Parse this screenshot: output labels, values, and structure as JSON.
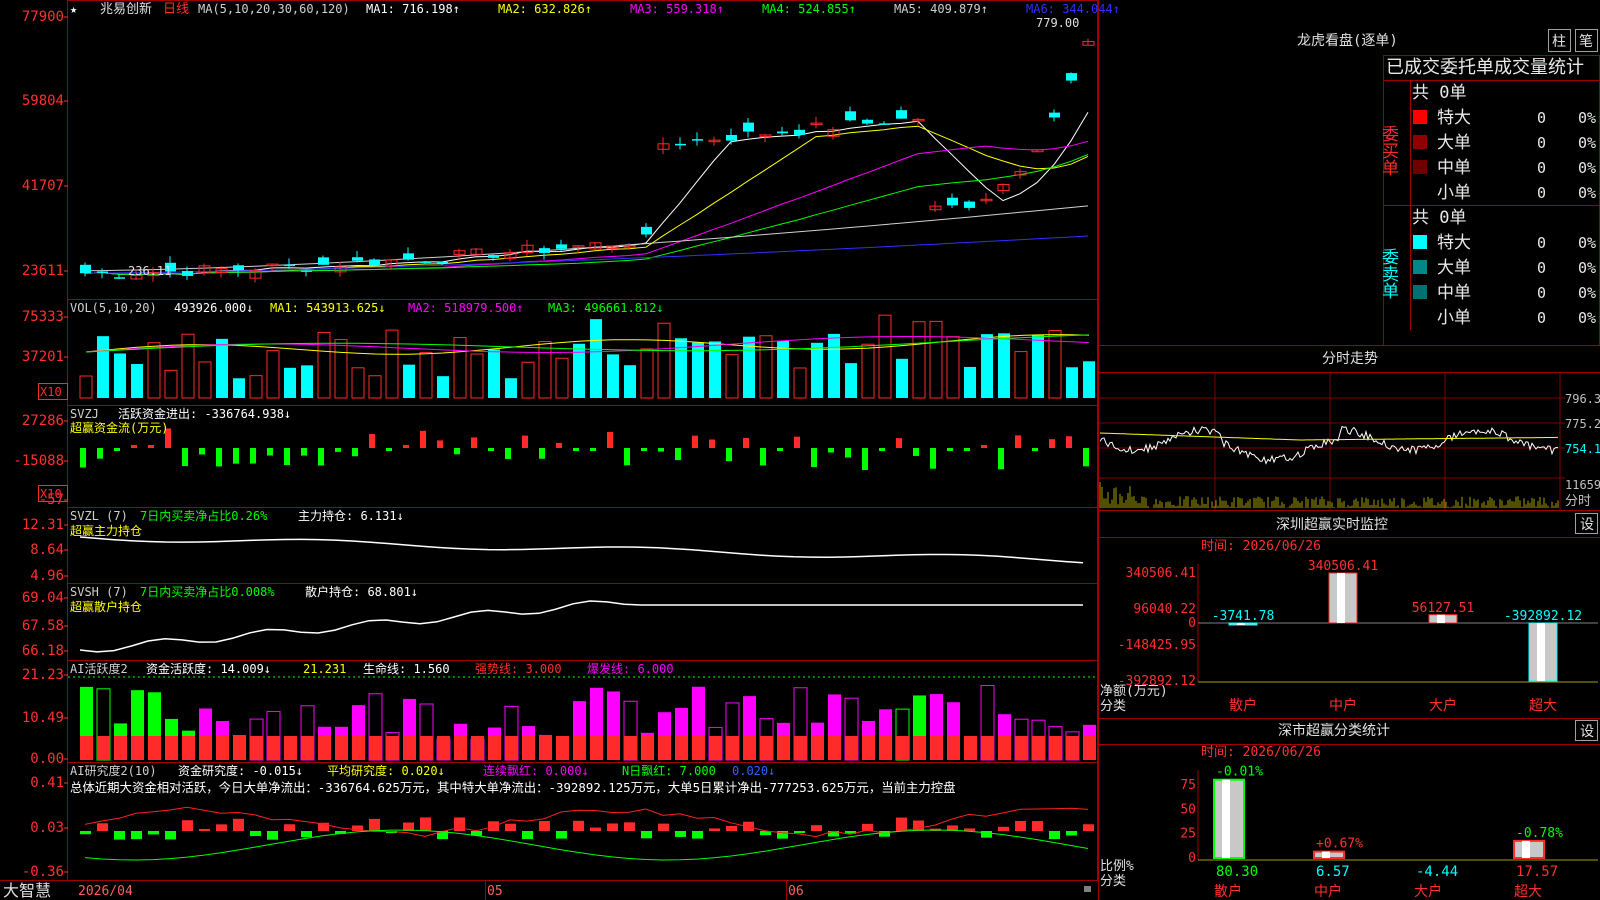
{
  "app": {
    "name": "大智慧",
    "stock_name": "兆易创新",
    "period": "日线",
    "star": "★"
  },
  "colors": {
    "up": "#ff2a2a",
    "down": "#00ffff",
    "frame": "#a00000",
    "white": "#e8e8e8",
    "yellow": "#ffff00",
    "magenta": "#ff00ff",
    "green": "#00ff00",
    "blue": "#4040ff",
    "gray": "#b0b0b0",
    "grid": "#800000"
  },
  "main": {
    "y_labels": [
      "77900",
      "59804",
      "41707",
      "23611"
    ],
    "ma_title": "MA(5,10,20,30,60,120)",
    "ma": [
      {
        "label": "MA1: 716.198↑",
        "color": "#ffffff"
      },
      {
        "label": "MA2: 632.826↑",
        "color": "#ffff00"
      },
      {
        "label": "MA3: 559.318↑",
        "color": "#ff00ff"
      },
      {
        "label": "MA4: 524.855↑",
        "color": "#00ff00"
      },
      {
        "label": "MA5: 409.879↑",
        "color": "#d0d0d0"
      },
      {
        "label": "MA6: 344.044↑",
        "color": "#3030ff"
      }
    ],
    "high_mark": "779.00",
    "low_mark": "236.11"
  },
  "vol": {
    "title": "VOL(5,10,20)",
    "value": "493926.000↓",
    "ma1": "MA1: 543913.625↓",
    "ma2": "MA2: 518979.500↑",
    "ma3": "MA3: 496661.812↓",
    "y_labels": [
      "75333",
      "37201"
    ],
    "unit": "X10"
  },
  "svzj": {
    "title": "SVZJ",
    "label": "活跃资金进出: -336764.938↓",
    "sub": "超赢资金流(万元)",
    "y_labels": [
      "27286",
      "-15088",
      "-57"
    ],
    "unit": "X10"
  },
  "svzl": {
    "title": "SVZL (7)",
    "ratio": "7日内买卖净占比0.26%",
    "hold": "主力持仓: 6.131↓",
    "sub": "超赢主力持仓",
    "y_labels": [
      "12.31",
      "8.64",
      "4.96"
    ]
  },
  "svsh": {
    "title": "SVSH (7)",
    "ratio": "7日内买卖净占比0.008%",
    "hold": "散户持仓: 68.801↓",
    "sub": "超赢散户持仓",
    "y_labels": [
      "69.04",
      "67.58",
      "66.18"
    ]
  },
  "ai1": {
    "title": "AI活跃度2",
    "a": "资金活跃度: 14.009↓",
    "b": "21.231",
    "c": "生命线: 1.560",
    "d": "强势线: 3.000",
    "e": "爆发线: 6.000",
    "y_labels": [
      "21.23",
      "10.49",
      "0.00"
    ]
  },
  "ai2": {
    "title": "AI研究度2(10)",
    "a": "资金研究度: -0.015↓",
    "b": "平均研究度: 0.020↓",
    "c": "连续飘红: 0.000↓",
    "d": "N日飘红: 7.000",
    "e": "0.020↓",
    "summary": "总体近期大资金相对活跃，今日大单净流出：-336764.625万元，其中特大单净流出：-392892.125万元，大单5日累计净出-777253.625万元，当前主力控盘",
    "y_labels": [
      "0.41",
      "0.03",
      "-0.36"
    ]
  },
  "dates": [
    "2026/04",
    "05",
    "06"
  ],
  "right": {
    "dragon_title": "龙虎看盘(逐单)",
    "btn_bar": "柱",
    "btn_pen": "笔",
    "stats_title": "已成交委托单成交量统计",
    "buy_label": "委买单",
    "sell_label": "委卖单",
    "buy_total": "共 0单",
    "sell_total": "共 0单",
    "buy_rows": [
      {
        "name": "特大",
        "v": "0",
        "p": "0%",
        "color": "#ff0000"
      },
      {
        "name": "大单",
        "v": "0",
        "p": "0%",
        "color": "#900000"
      },
      {
        "name": "中单",
        "v": "0",
        "p": "0%",
        "color": "#700000"
      },
      {
        "name": "小单",
        "v": "0",
        "p": "0%",
        "color": ""
      }
    ],
    "sell_rows": [
      {
        "name": "特大",
        "v": "0",
        "p": "0%",
        "color": "#00ffff"
      },
      {
        "name": "大单",
        "v": "0",
        "p": "0%",
        "color": "#008888"
      },
      {
        "name": "中单",
        "v": "0",
        "p": "0%",
        "color": "#007070"
      },
      {
        "name": "小单",
        "v": "0",
        "p": "0%",
        "color": ""
      }
    ],
    "intraday_title": "分时走势",
    "intraday_y": [
      "796.3",
      "775.2",
      "754.1"
    ],
    "intraday_vol": "11659",
    "intraday_unit": "分时",
    "sz_title": "深圳超赢实时监控",
    "sz_time": "时间: 2026/06/26",
    "sz_y": [
      "340506.41",
      "96040.22",
      "0",
      "-148425.95",
      "-392892.12"
    ],
    "sz_unit1": "净额(万元)",
    "sz_unit2": "分类",
    "sz_cats": [
      "散户",
      "中户",
      "大户",
      "超大"
    ],
    "sz_vals": [
      -3741.78,
      340506.41,
      56127.51,
      -392892.12
    ],
    "sz_val_labels": [
      "-3741.78",
      "340506.41",
      "56127.51",
      "-392892.12"
    ],
    "set": "设",
    "cls_title": "深市超赢分类统计",
    "cls_time": "时间: 2026/06/26",
    "cls_y": [
      "75",
      "50",
      "25",
      "0"
    ],
    "cls_top": [
      "-0.01%",
      "+0.67%",
      "",
      "-0.78%"
    ],
    "cls_vals": [
      80.3,
      6.57,
      -4.44,
      17.57
    ],
    "cls_val_labels": [
      "80.30",
      "6.57",
      "-4.44",
      "17.57"
    ],
    "cls_unit1": "比例%",
    "cls_unit2": "分类",
    "cls_cats": [
      "散户",
      "中户",
      "大户",
      "超大"
    ]
  }
}
